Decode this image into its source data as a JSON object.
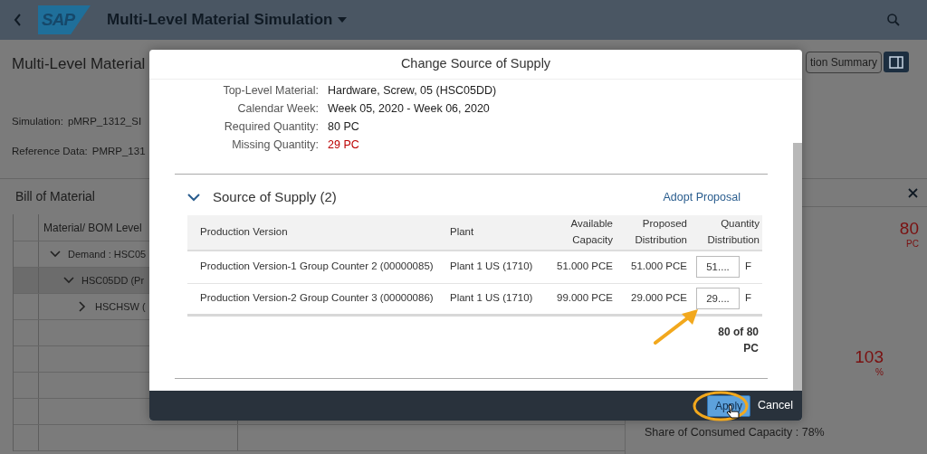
{
  "header": {
    "logo": "SAP",
    "title": "Multi-Level Material Simulation"
  },
  "page": {
    "title": "Multi-Level Material",
    "fields": [
      {
        "label": "Simulation:",
        "value": "pMRP_1312_SI"
      },
      {
        "label": "Reference Data:",
        "value": "PMRP_131"
      }
    ],
    "summary_button": "tion Summary"
  },
  "bom": {
    "title": "Bill of Material",
    "column": "Material/ BOM Level",
    "rows": [
      {
        "label": "Demand : HSC05",
        "expanded": true,
        "selected": false,
        "children": [
          {
            "label": "HSC05DD (Pr",
            "expanded": true,
            "selected": true,
            "children": [
              {
                "label": "HSCHSW (",
                "expanded": false,
                "selected": false
              }
            ]
          }
        ]
      }
    ]
  },
  "side_panel": {
    "kpis": [
      {
        "value": "80",
        "unit": "PC"
      },
      {
        "value": "103",
        "unit": "%"
      }
    ],
    "share": "Share of Consumed Capacity : 78%"
  },
  "dialog": {
    "title": "Change Source of Supply",
    "fields": [
      {
        "label": "Top-Level Material:",
        "value": "Hardware, Screw, 05  (HSC05DD)",
        "negative": false
      },
      {
        "label": "Calendar Week:",
        "value": "Week 05, 2020 - Week 06, 2020",
        "negative": false
      },
      {
        "label": "Required Quantity:",
        "value": "80 PC",
        "negative": false
      },
      {
        "label": "Missing Quantity:",
        "value": "29 PC",
        "negative": true
      }
    ],
    "section": {
      "title": "Source of Supply (2)",
      "expanded": true,
      "action": "Adopt Proposal"
    },
    "table": {
      "columns": [
        "Production Version",
        "Plant",
        "Available Capacity",
        "Proposed Distribution",
        "Quantity Distribution"
      ],
      "rows": [
        {
          "version": "Production Version-1 Group Counter 2 (00000085)",
          "plant": "Plant 1 US (1710)",
          "available": "51.000 PCE",
          "proposed": "51.000 PCE",
          "quantity": "51....",
          "unit": "F"
        },
        {
          "version": "Production Version-2 Group Counter 3 (00000086)",
          "plant": "Plant 1 US (1710)",
          "available": "99.000 PCE",
          "proposed": "29.000 PCE",
          "quantity": "29....",
          "unit": "F"
        }
      ],
      "total": "80 of 80 PC"
    },
    "buttons": [
      {
        "label": "Apply",
        "emphasized": true
      },
      {
        "label": "Cancel",
        "emphasized": false
      }
    ]
  }
}
